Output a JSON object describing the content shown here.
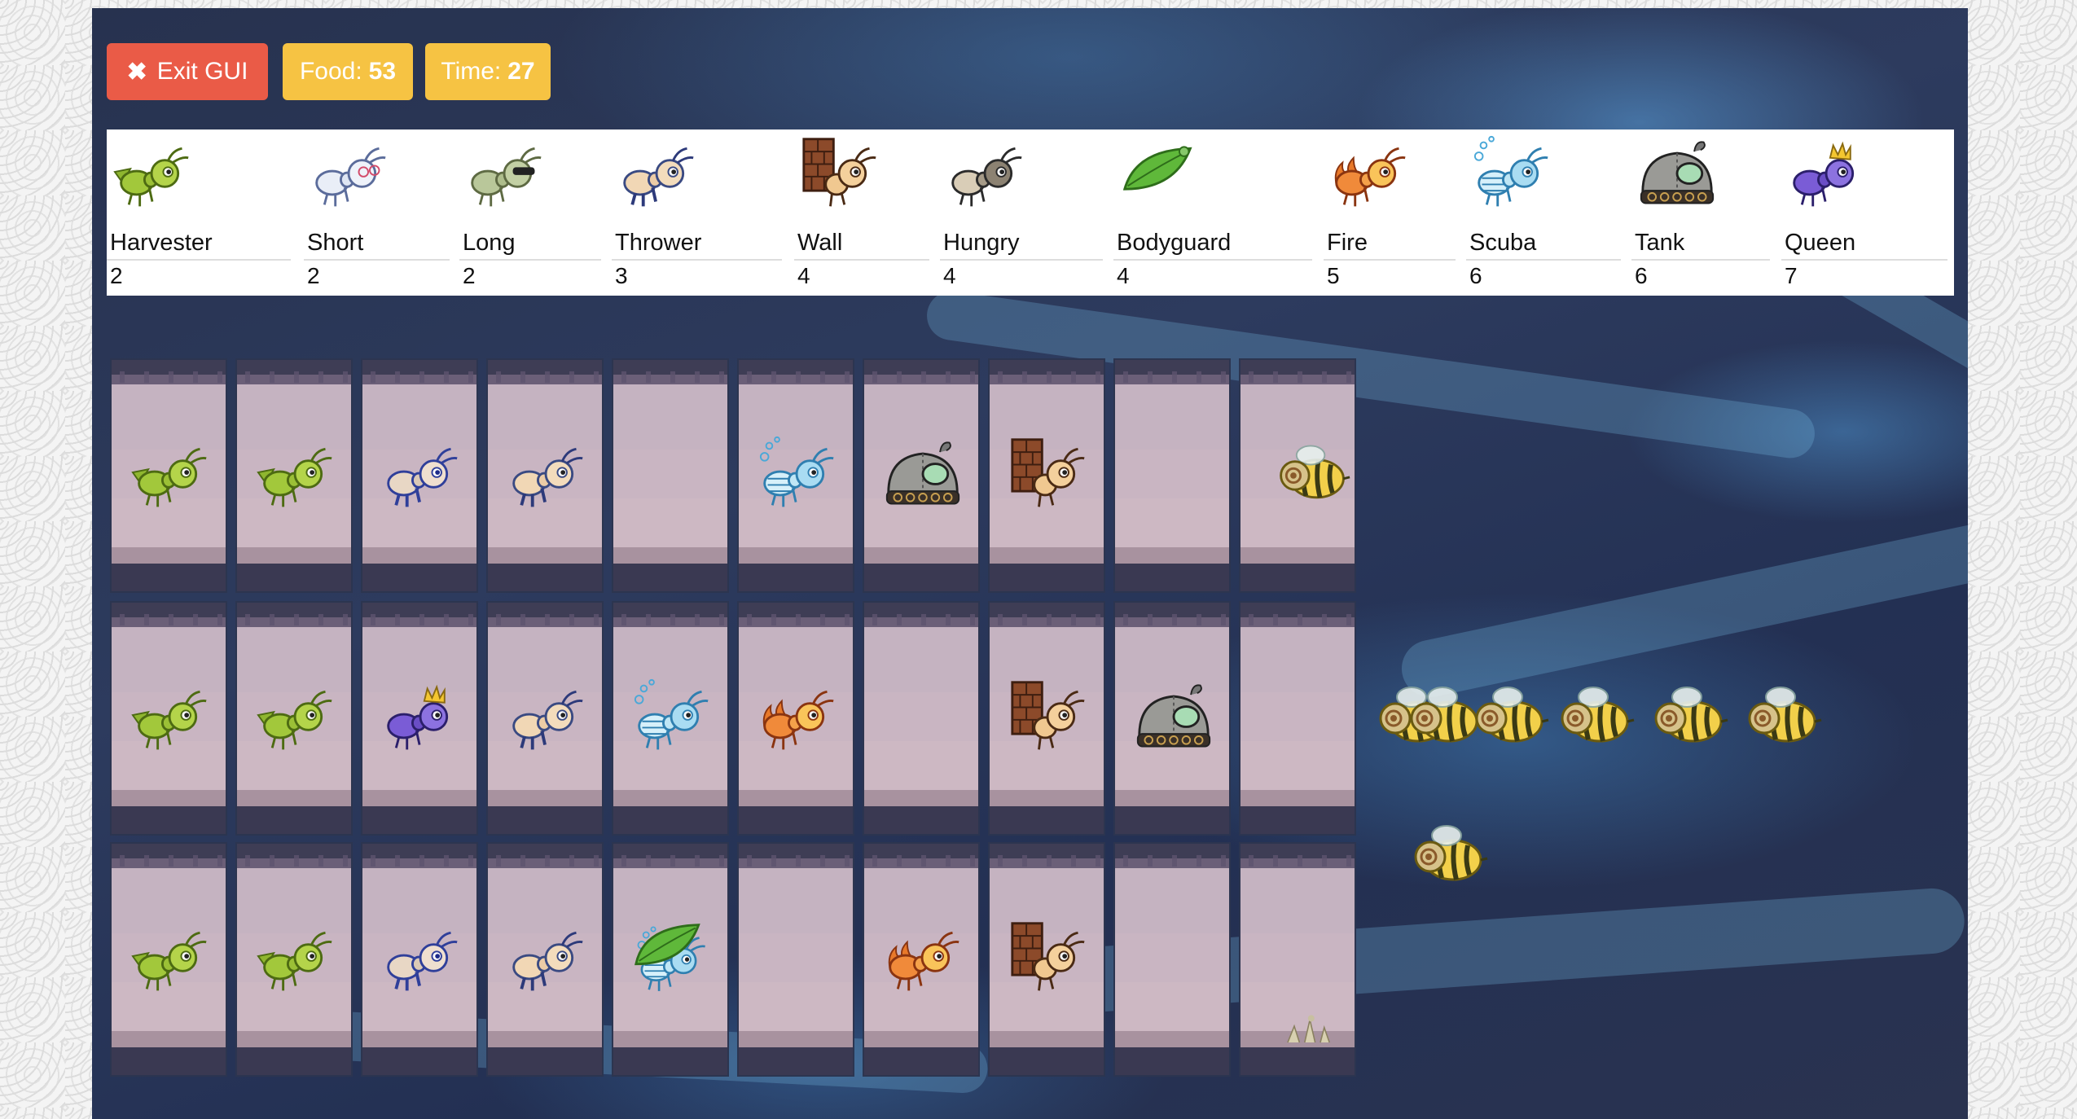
{
  "toolbar": {
    "exit_label": "Exit GUI",
    "food_label": "Food:",
    "food_value": "53",
    "time_label": "Time:",
    "time_value": "27"
  },
  "ant_types": [
    {
      "name": "Harvester",
      "cost": "2",
      "icon": "harvester-ant-icon"
    },
    {
      "name": "Short",
      "cost": "2",
      "icon": "short-thrower-ant-icon"
    },
    {
      "name": "Long",
      "cost": "2",
      "icon": "long-thrower-ant-icon"
    },
    {
      "name": "Thrower",
      "cost": "3",
      "icon": "thrower-ant-icon"
    },
    {
      "name": "Wall",
      "cost": "4",
      "icon": "wall-ant-icon"
    },
    {
      "name": "Hungry",
      "cost": "4",
      "icon": "hungry-ant-icon"
    },
    {
      "name": "Bodyguard",
      "cost": "4",
      "icon": "bodyguard-leaf-icon"
    },
    {
      "name": "Fire",
      "cost": "5",
      "icon": "fire-ant-icon"
    },
    {
      "name": "Scuba",
      "cost": "6",
      "icon": "scuba-ant-icon"
    },
    {
      "name": "Tank",
      "cost": "6",
      "icon": "tank-ant-icon"
    },
    {
      "name": "Queen",
      "cost": "7",
      "icon": "queen-ant-icon"
    }
  ],
  "board": {
    "rows": [
      [
        "harvester",
        "harvester",
        "thrower-blue",
        "thrower",
        "",
        "scuba",
        "tank",
        "wall",
        "",
        "bee"
      ],
      [
        "harvester",
        "harvester",
        "queen",
        "thrower",
        "scuba",
        "fire",
        "",
        "wall",
        "tank",
        ""
      ],
      [
        "harvester",
        "harvester",
        "thrower-blue",
        "thrower",
        "bodyguard-scuba",
        "",
        "fire",
        "wall",
        "",
        "hive-debris"
      ]
    ],
    "incoming_bees": {
      "row_2_count": 6,
      "row_3_count": 1
    }
  },
  "colors": {
    "exit_button": "#ea5b47",
    "badge": "#f6c343",
    "panel": "#ffffff",
    "tunnel_bg": "#c5b3c1"
  }
}
